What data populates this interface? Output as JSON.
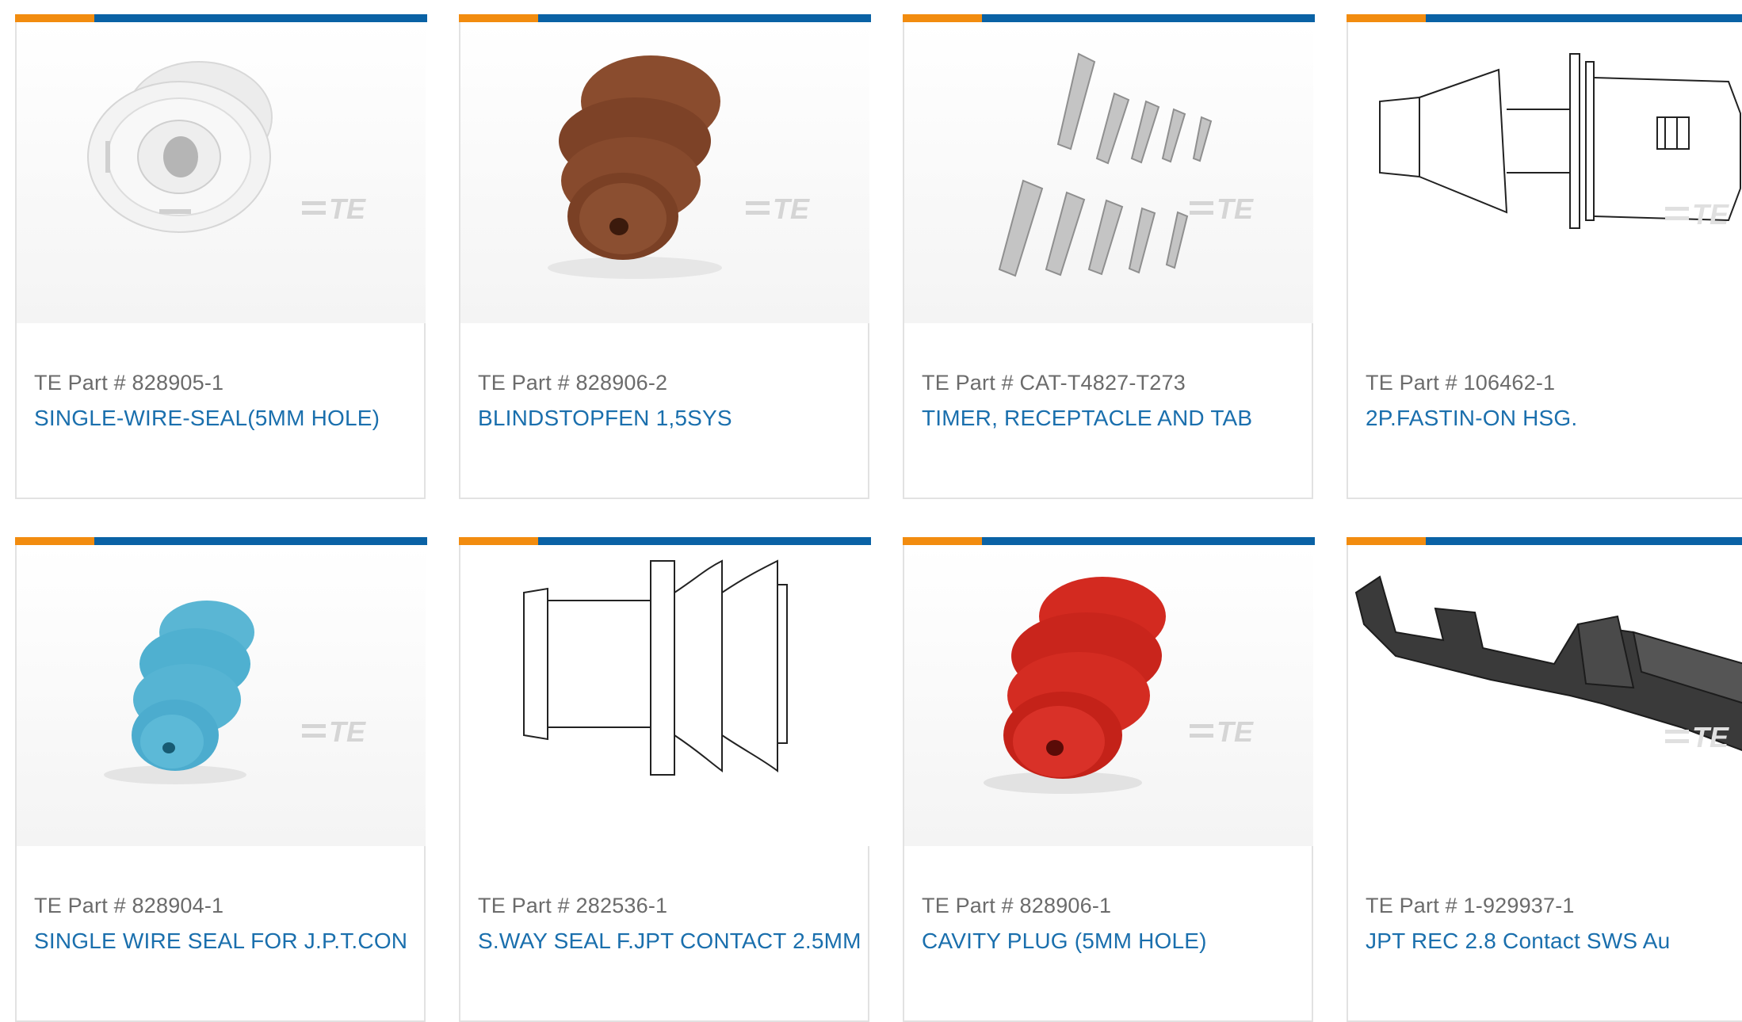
{
  "products": [
    {
      "part_label": "TE Part # 828905-1",
      "description": "SINGLE-WIRE-SEAL(5MM HOLE)",
      "image_icon": "white-seal-icon",
      "logo": "TE"
    },
    {
      "part_label": "TE Part # 828906-2",
      "description": "BLINDSTOPFEN 1,5SYS",
      "image_icon": "brown-plug-icon",
      "logo": "TE"
    },
    {
      "part_label": "TE Part # CAT-T4827-T273",
      "description": "TIMER, RECEPTACLE AND TAB",
      "image_icon": "terminal-set-icon",
      "logo": "TE"
    },
    {
      "part_label": "TE Part # 106462-1",
      "description": "2P.FASTIN-ON HSG.",
      "image_icon": "housing-drawing-icon",
      "logo": "TE"
    },
    {
      "part_label": "TE Part # 828904-1",
      "description": "SINGLE WIRE SEAL FOR J.P.T.CON",
      "image_icon": "blue-seal-icon",
      "logo": "TE"
    },
    {
      "part_label": "TE Part # 282536-1",
      "description": "S.WAY SEAL F.JPT CONTACT 2.5MM",
      "image_icon": "seal-drawing-icon",
      "logo": "TE"
    },
    {
      "part_label": "TE Part # 828906-1",
      "description": "CAVITY PLUG (5MM HOLE)",
      "image_icon": "red-plug-icon",
      "logo": "TE"
    },
    {
      "part_label": "TE Part # 1-929937-1",
      "description": "JPT REC 2.8 Contact SWS Au",
      "image_icon": "contact-icon",
      "logo": "TE"
    }
  ],
  "colors": {
    "accent_orange": "#f28c0f",
    "accent_blue": "#0a62a5",
    "link": "#1a6fad",
    "muted_text": "#6b6b6b"
  }
}
